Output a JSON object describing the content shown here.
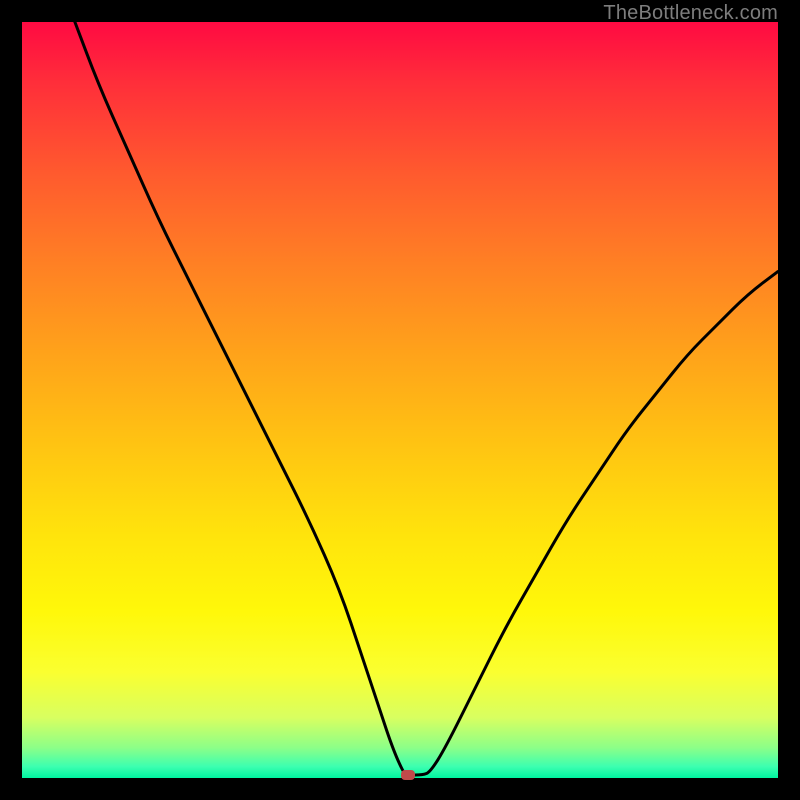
{
  "attribution": "TheBottleneck.com",
  "chart_data": {
    "type": "line",
    "title": "",
    "xlabel": "",
    "ylabel": "",
    "xlim": [
      0,
      100
    ],
    "ylim": [
      0,
      100
    ],
    "series": [
      {
        "name": "curve",
        "x": [
          7,
          10,
          14,
          18,
          22,
          26,
          30,
          34,
          38,
          42,
          45,
          47,
          49,
          50.5,
          51,
          53,
          54,
          56,
          60,
          64,
          68,
          72,
          76,
          80,
          84,
          88,
          92,
          96,
          100
        ],
        "values": [
          100,
          92,
          83,
          74,
          66,
          58,
          50,
          42,
          34,
          25,
          16,
          10,
          4,
          0.6,
          0.4,
          0.4,
          0.8,
          4,
          12,
          20,
          27,
          34,
          40,
          46,
          51,
          56,
          60,
          64,
          67
        ]
      }
    ],
    "marker": {
      "x": 51,
      "y": 0.4,
      "color": "#c04a4a"
    },
    "background_gradient": {
      "stops": [
        {
          "pos": 0,
          "color": "#ff0a42"
        },
        {
          "pos": 0.5,
          "color": "#ffc412"
        },
        {
          "pos": 0.78,
          "color": "#fff80a"
        },
        {
          "pos": 1.0,
          "color": "#00f5a0"
        }
      ]
    }
  }
}
